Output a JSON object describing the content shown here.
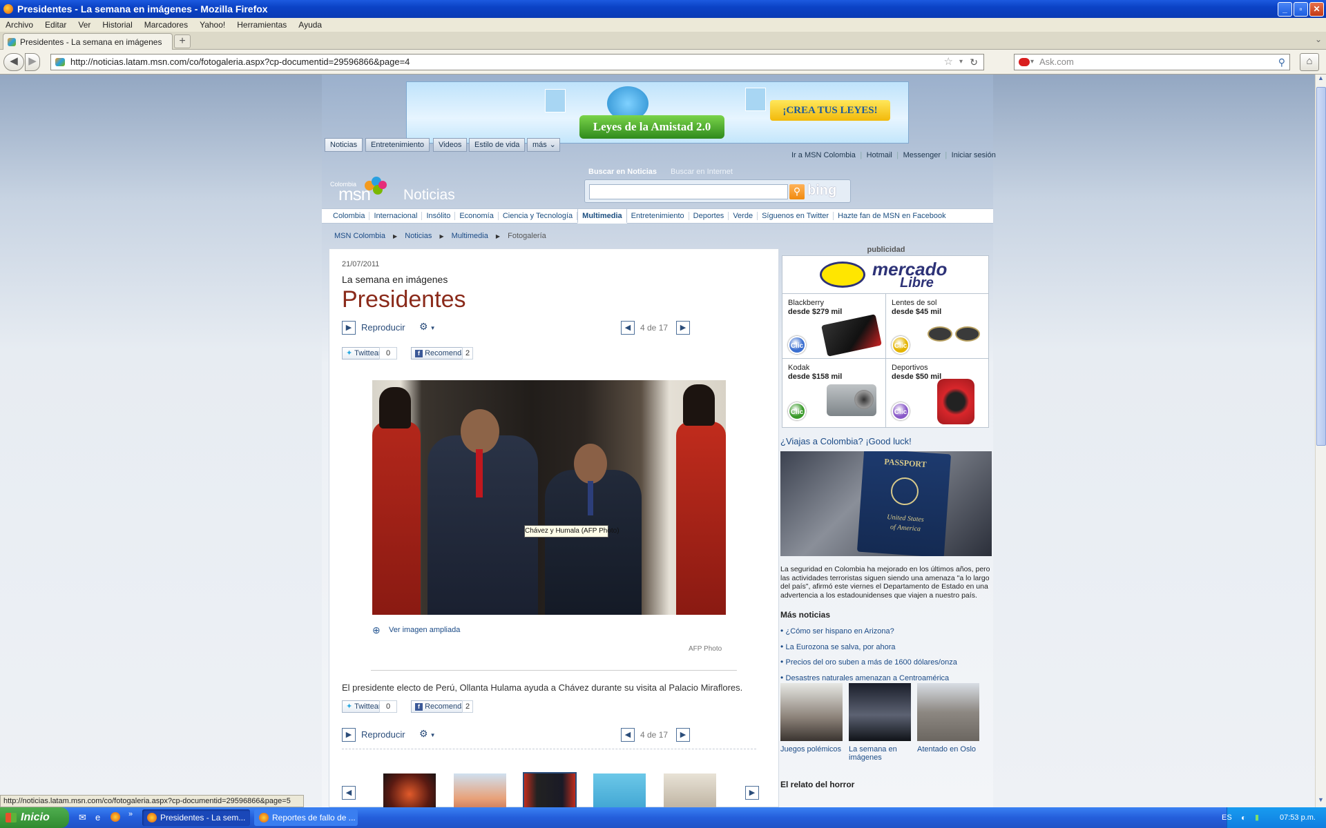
{
  "window": {
    "title": "Presidentes - La semana en imágenes - Mozilla Firefox",
    "min": "_",
    "max": "▫",
    "close": "✕"
  },
  "menu": [
    "Archivo",
    "Editar",
    "Ver",
    "Historial",
    "Marcadores",
    "Yahoo!",
    "Herramientas",
    "Ayuda"
  ],
  "tab": {
    "title": "Presidentes - La semana en imágenes",
    "close": "×",
    "new_tab": "+"
  },
  "nav": {
    "url": "http://noticias.latam.msn.com/co/fotogaleria.aspx?cp-documentid=29596866&page=4",
    "search_placeholder": "Ask.com",
    "back": "◀",
    "forward": "▶",
    "reload": "↻",
    "home": "⌂"
  },
  "banner": {
    "title": "Leyes de la Amistad 2.0",
    "cta": "¡CREA TUS LEYES!"
  },
  "msn_topnav": {
    "pills": [
      "Noticias",
      "Entretenimiento",
      "Videos",
      "Estilo de vida",
      "más"
    ],
    "links": [
      "Ir a MSN Colombia",
      "Hotmail",
      "Messenger",
      "Iniciar sesión"
    ]
  },
  "brand": {
    "country": "Colombia",
    "logo": "msn",
    "section": "Noticias"
  },
  "search": {
    "tab_active": "Buscar en Noticias",
    "tab_other": "Buscar en Internet",
    "engine": "bing"
  },
  "section_nav": {
    "items": [
      "Colombia",
      "Internacional",
      "Insólito",
      "Economía",
      "Ciencia y Tecnología",
      "Multimedia",
      "Entretenimiento",
      "Deportes",
      "Verde",
      "Síguenos en Twitter",
      "Hazte fan de MSN en Facebook"
    ],
    "active": "Multimedia"
  },
  "breadcrumb": [
    "MSN Colombia",
    "Noticias",
    "Multimedia",
    "Fotogalería"
  ],
  "article": {
    "date": "21/07/2011",
    "kicker": "La semana en imágenes",
    "title": "Presidentes",
    "play": "Reproducir",
    "counter": "4 de 17",
    "twitter": "Twittear",
    "twitter_count": "0",
    "facebook": "Recomendar",
    "facebook_count": "2",
    "tooltip": "Chávez y Humala (AFP Photo)",
    "zoom": "Ver imagen ampliada",
    "credit": "AFP Photo",
    "caption": "El presidente electo de Perú, Ollanta Hulama ayuda a Chávez durante su visita al Palacio Miraflores."
  },
  "ad": {
    "label": "publicidad",
    "brand_line1": "mercado",
    "brand_line2": "Libre",
    "items": [
      {
        "name": "Blackberry",
        "price": "desde $279 mil",
        "btn": "Clic",
        "color": "#3b6fd0"
      },
      {
        "name": "Lentes de sol",
        "price": "desde $45 mil",
        "btn": "Clic",
        "color": "#e4b400"
      },
      {
        "name": "Kodak",
        "price": "desde $158 mil",
        "btn": "Clic",
        "color": "#3a9a2a"
      },
      {
        "name": "Deportivos",
        "price": "desde $50 mil",
        "btn": "Clic",
        "color": "#8a5ac8"
      }
    ]
  },
  "sidebar": {
    "story_title": "¿Viajas a Colombia? ¡Good luck!",
    "passport_line1": "PASSPORT",
    "passport_line2": "United States",
    "passport_line3": "of America",
    "story_text": "La seguridad en Colombia ha mejorado en los últimos años, pero las actividades terroristas siguen siendo una amenaza \"a lo largo del país\", afirmó este viernes el Departamento de Estado en una advertencia a los estadounidenses que viajen a nuestro país.",
    "more_title": "Más noticias",
    "more": [
      "¿Cómo ser hispano en Arizona?",
      "La Eurozona se salva, por ahora",
      "Precios del oro suben a más de 1600 dólares/onza",
      "Desastres naturales amenazan a Centroamérica"
    ],
    "thumbs": [
      "Juegos polémicos",
      "La semana en imágenes",
      "Atentado en Oslo"
    ],
    "next_heading": "El relato del horror"
  },
  "status": "http://noticias.latam.msn.com/co/fotogaleria.aspx?cp-documentid=29596866&page=5",
  "taskbar": {
    "start": "Inicio",
    "windows": [
      "Presidentes - La sem...",
      "Reportes de fallo de ..."
    ],
    "lang": "ES",
    "time": "07:53 p.m."
  }
}
